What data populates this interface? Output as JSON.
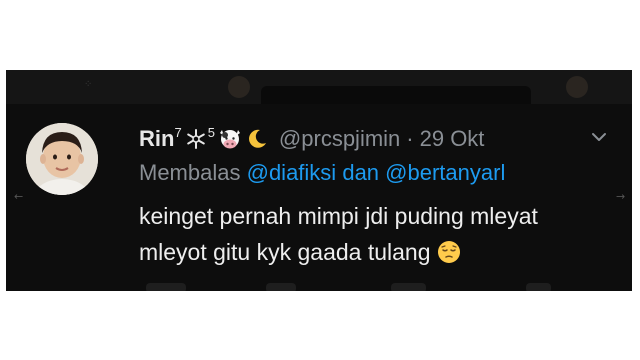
{
  "tweet": {
    "display_name": "Rin",
    "name_sup_1": "7",
    "name_sup_2": "5",
    "name_emoji_1": "snowflake-emoji",
    "name_emoji_2": "cow-face-emoji",
    "name_emoji_3": "crescent-moon-emoji",
    "handle": "@prcspjimin",
    "separator": "·",
    "timestamp": "29 Okt",
    "reply_prefix": "Membalas",
    "reply_mention_1": "@diafiksi",
    "reply_joiner": "dan",
    "reply_mention_2": "@bertanyarl",
    "body_line_1": "keinget pernah mimpi jdi puding mleyat",
    "body_line_2": "mleyot gitu kyk gaada tulang",
    "body_emoji": "pensive-face-emoji"
  },
  "nav": {
    "left_arrow": "←",
    "right_arrow": "→"
  },
  "colors": {
    "background": "#0d0d0d",
    "name": "#e6e6e6",
    "muted": "#8a8f95",
    "mention": "#1d9bf0",
    "body": "#eeeeee"
  }
}
